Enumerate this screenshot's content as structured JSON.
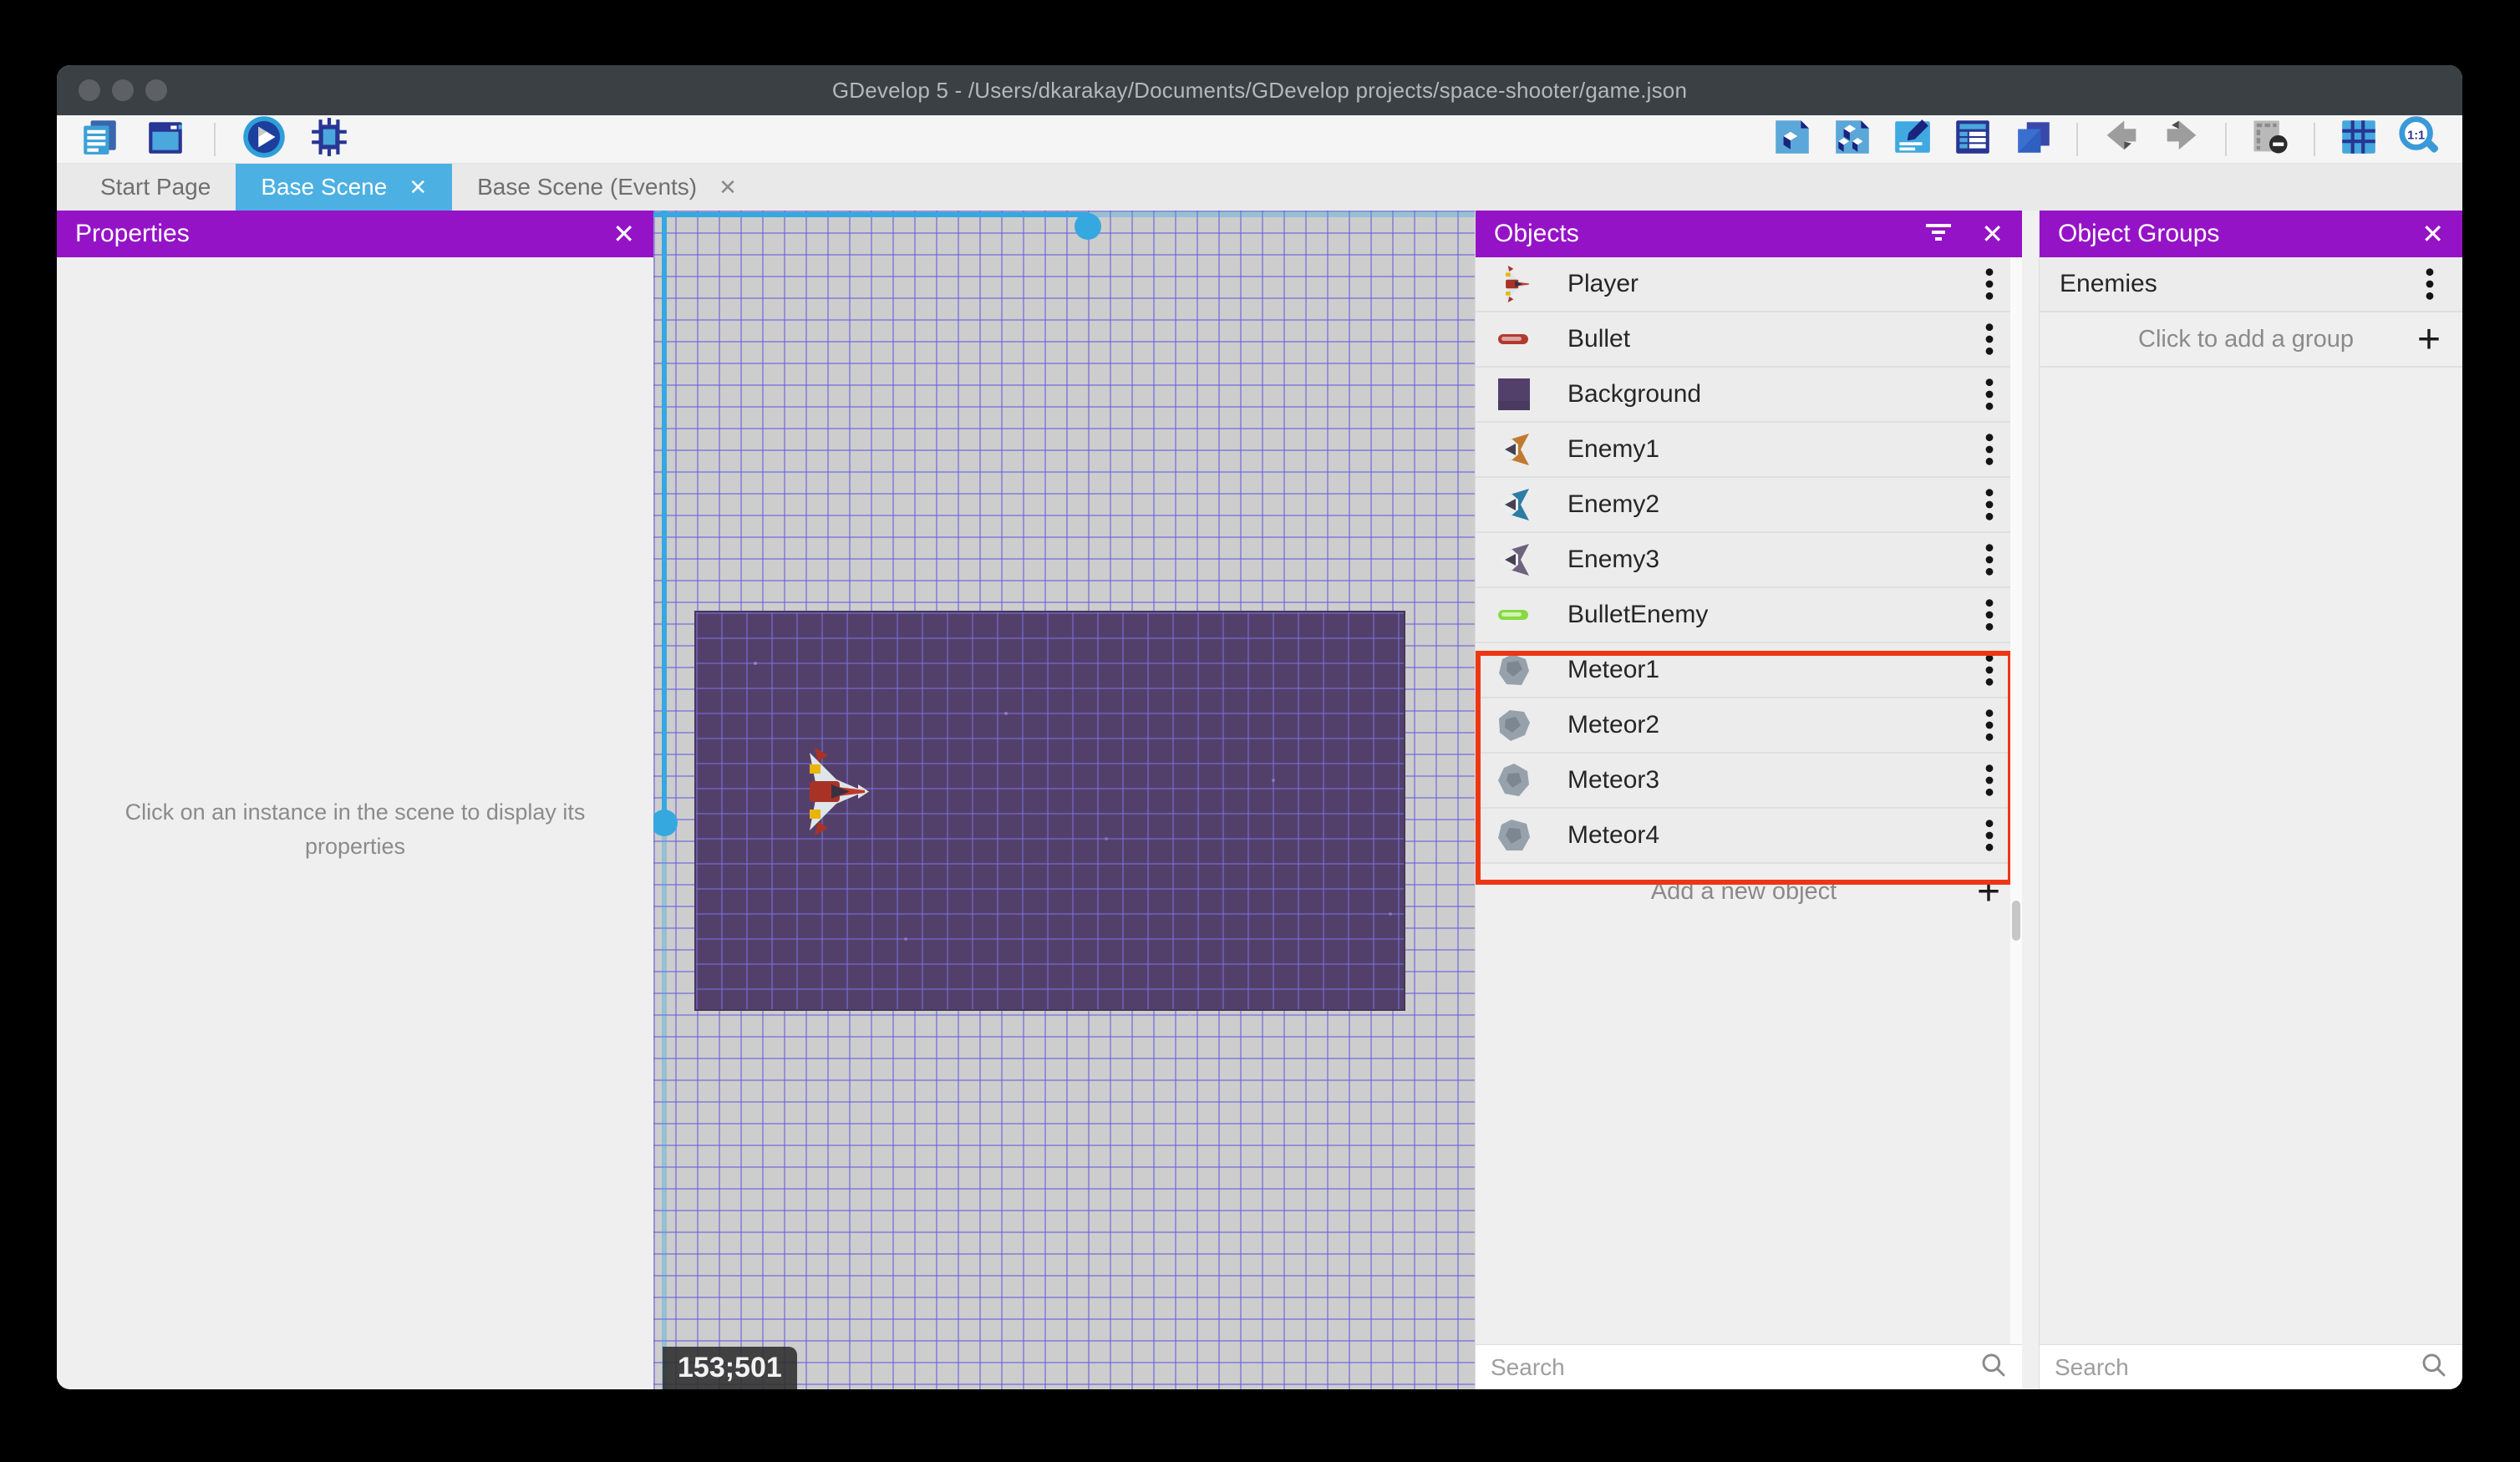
{
  "window_title": "GDevelop 5 - /Users/dkarakay/Documents/GDevelop projects/space-shooter/game.json",
  "toolbar": {
    "left_icons": [
      "project-manager-icon",
      "scene-window-icon",
      "play-icon",
      "debug-icon"
    ],
    "right_icons": [
      "objects-editor-icon",
      "object-groups-editor-icon",
      "properties-editor-icon",
      "instances-list-icon",
      "layers-icon",
      "undo-icon",
      "redo-icon",
      "window-mask-icon",
      "grid-icon",
      "zoom-one-to-one-icon"
    ]
  },
  "tabs": {
    "items": [
      {
        "label": "Start Page",
        "active": false,
        "closable": false
      },
      {
        "label": "Base Scene",
        "active": true,
        "closable": true
      },
      {
        "label": "Base Scene (Events)",
        "active": false,
        "closable": true
      }
    ]
  },
  "properties_panel": {
    "title": "Properties",
    "empty_message": "Click on an instance in the scene to display its properties"
  },
  "scene": {
    "coordinate_badge": "153;501"
  },
  "objects_panel": {
    "title": "Objects",
    "add_label": "Add a new object",
    "search_placeholder": "Search",
    "items": [
      {
        "label": "Player",
        "icon": "player-object-icon"
      },
      {
        "label": "Bullet",
        "icon": "bullet-object-icon"
      },
      {
        "label": "Background",
        "icon": "background-object-icon"
      },
      {
        "label": "Enemy1",
        "icon": "enemy1-object-icon"
      },
      {
        "label": "Enemy2",
        "icon": "enemy2-object-icon"
      },
      {
        "label": "Enemy3",
        "icon": "enemy3-object-icon"
      },
      {
        "label": "BulletEnemy",
        "icon": "bullet-enemy-object-icon"
      },
      {
        "label": "Meteor1",
        "icon": "meteor1-object-icon"
      },
      {
        "label": "Meteor2",
        "icon": "meteor2-object-icon"
      },
      {
        "label": "Meteor3",
        "icon": "meteor3-object-icon"
      },
      {
        "label": "Meteor4",
        "icon": "meteor4-object-icon"
      }
    ],
    "highlight": {
      "first_label": "Meteor1",
      "last_label": "Meteor4",
      "color": "#ee3614"
    }
  },
  "groups_panel": {
    "title": "Object Groups",
    "groups": [
      {
        "label": "Enemies"
      }
    ],
    "add_label": "Click to add a group",
    "search_placeholder": "Search"
  },
  "colors": {
    "panel_header": "#9513c6",
    "active_tab": "#4cb0e2",
    "selection_blue": "#35a8e0",
    "highlight_red": "#ee3614",
    "canvas_background": "#cdcdcd",
    "grid_line": "#675ee0",
    "background_object": "#53406a"
  }
}
